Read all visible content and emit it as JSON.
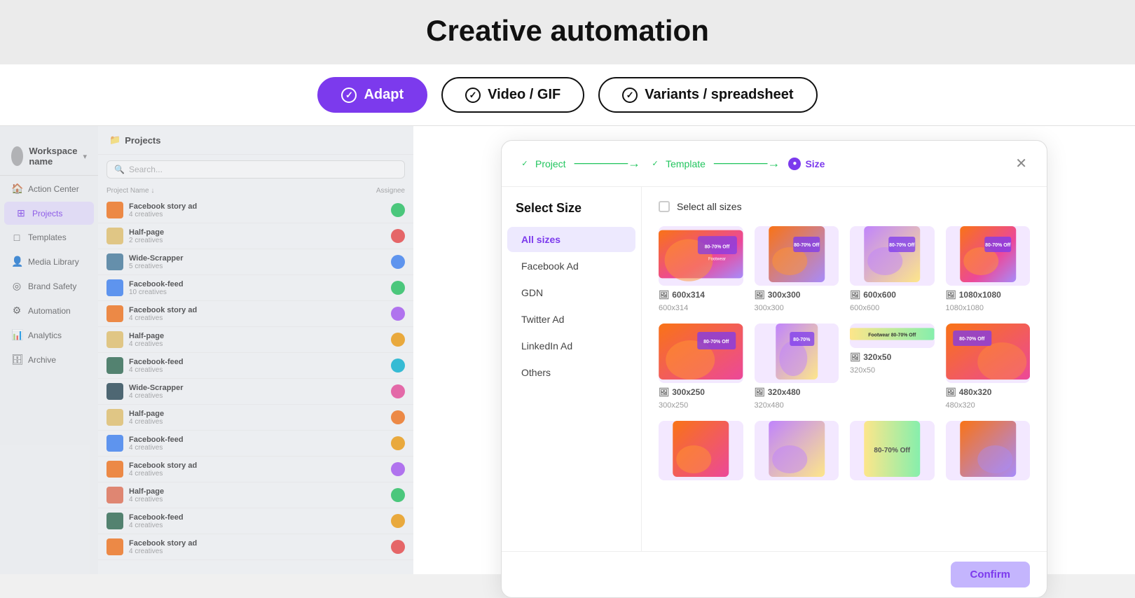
{
  "page": {
    "title": "Creative automation"
  },
  "tabs": [
    {
      "id": "adapt",
      "label": "Adapt",
      "state": "active"
    },
    {
      "id": "video-gif",
      "label": "Video / GIF",
      "state": "inactive"
    },
    {
      "id": "variants-spreadsheet",
      "label": "Variants / spreadsheet",
      "state": "inactive"
    }
  ],
  "sidebar": {
    "workspace_label": "Workspace name",
    "nav_items": [
      {
        "id": "action-center",
        "label": "Action Center",
        "icon": "🏠"
      },
      {
        "id": "projects",
        "label": "Projects",
        "icon": "⊞",
        "active": true
      },
      {
        "id": "templates",
        "label": "Templates",
        "icon": "□"
      },
      {
        "id": "media-library",
        "label": "Media Library",
        "icon": "👤"
      },
      {
        "id": "brand-safety",
        "label": "Brand Safety",
        "icon": "◎"
      },
      {
        "id": "automation",
        "label": "Automation",
        "icon": "⚙"
      },
      {
        "id": "analytics",
        "label": "Analytics",
        "icon": "📊"
      },
      {
        "id": "archive",
        "label": "Archive",
        "icon": "🗄"
      }
    ],
    "projects_title": "Projects",
    "search_placeholder": "Search...",
    "col_headers": [
      "Project Name ↓",
      "Assignee"
    ],
    "projects": [
      {
        "name": "Facebook story ad",
        "sub": "4 creatives",
        "color": "c1"
      },
      {
        "name": "Half-page",
        "sub": "2 creatives",
        "color": "c2"
      },
      {
        "name": "Wide-Scrapper",
        "sub": "5 creatives",
        "color": "c3"
      },
      {
        "name": "Facebook-feed",
        "sub": "10 creatives",
        "color": "c4"
      },
      {
        "name": "Facebook story ad",
        "sub": "4 creatives",
        "color": "c5"
      },
      {
        "name": "Half-page",
        "sub": "4 creatives",
        "color": "c6"
      },
      {
        "name": "Facebook-feed",
        "sub": "4 creatives",
        "color": "c7"
      },
      {
        "name": "Wide-Scrapper",
        "sub": "4 creatives",
        "color": "c8"
      },
      {
        "name": "Half-page",
        "sub": "4 creatives",
        "color": "c9"
      },
      {
        "name": "Facebook-feed",
        "sub": "4 creatives",
        "color": "c1"
      },
      {
        "name": "Facebook story ad",
        "sub": "4 creatives",
        "color": "c2"
      },
      {
        "name": "Half-page",
        "sub": "4 creatives",
        "color": "c3"
      },
      {
        "name": "Facebook-feed",
        "sub": "4 creatives",
        "color": "c4"
      },
      {
        "name": "Facebook story ad",
        "sub": "4 creatives",
        "color": "c5"
      }
    ]
  },
  "modal": {
    "steps": [
      {
        "id": "project",
        "label": "Project",
        "state": "done"
      },
      {
        "id": "template",
        "label": "Template",
        "state": "done"
      },
      {
        "id": "size",
        "label": "Size",
        "state": "active"
      }
    ],
    "title": "Select Size",
    "select_all_label": "Select all sizes",
    "size_filters": [
      {
        "id": "all-sizes",
        "label": "All sizes",
        "active": true
      },
      {
        "id": "facebook-ad",
        "label": "Facebook Ad",
        "active": false
      },
      {
        "id": "gdn",
        "label": "GDN",
        "active": false
      },
      {
        "id": "twitter-ad",
        "label": "Twitter Ad",
        "active": false
      },
      {
        "id": "linkedin-ad",
        "label": "LinkedIn Ad",
        "active": false
      },
      {
        "id": "others",
        "label": "Others",
        "active": false
      }
    ],
    "sizes": [
      {
        "id": "600x314",
        "label": "600x314",
        "sub": "600x314",
        "color1": "#f97316",
        "color2": "#ec4899"
      },
      {
        "id": "300x300",
        "label": "300x300",
        "sub": "300x300",
        "color1": "#f97316",
        "color2": "#a78bfa"
      },
      {
        "id": "600x600",
        "label": "600x600",
        "sub": "600x600",
        "color1": "#c084fc",
        "color2": "#fde68a"
      },
      {
        "id": "1080x1080",
        "label": "1080x1080",
        "sub": "1080x1080",
        "color1": "#f97316",
        "color2": "#a78bfa"
      },
      {
        "id": "300x250",
        "label": "300x250",
        "sub": "300x250",
        "color1": "#f97316",
        "color2": "#ec4899"
      },
      {
        "id": "320x480",
        "label": "320x480",
        "sub": "320x480",
        "color1": "#c084fc",
        "color2": "#fde68a"
      },
      {
        "id": "320x50",
        "label": "320x50",
        "sub": "320x50",
        "color1": "#fde68a",
        "color2": "#86efac"
      },
      {
        "id": "480x320",
        "label": "480x320",
        "sub": "480x320",
        "color1": "#f97316",
        "color2": "#ec4899"
      },
      {
        "id": "bottom1",
        "label": "...",
        "sub": "...",
        "color1": "#f97316",
        "color2": "#ec4899"
      },
      {
        "id": "bottom2",
        "label": "...",
        "sub": "...",
        "color1": "#c084fc",
        "color2": "#fde68a"
      },
      {
        "id": "bottom3",
        "label": "...",
        "sub": "...",
        "color1": "#fde68a",
        "color2": "#86efac"
      },
      {
        "id": "bottom4",
        "label": "...",
        "sub": "...",
        "color1": "#f97316",
        "color2": "#a78bfa"
      }
    ],
    "confirm_label": "Confirm"
  }
}
